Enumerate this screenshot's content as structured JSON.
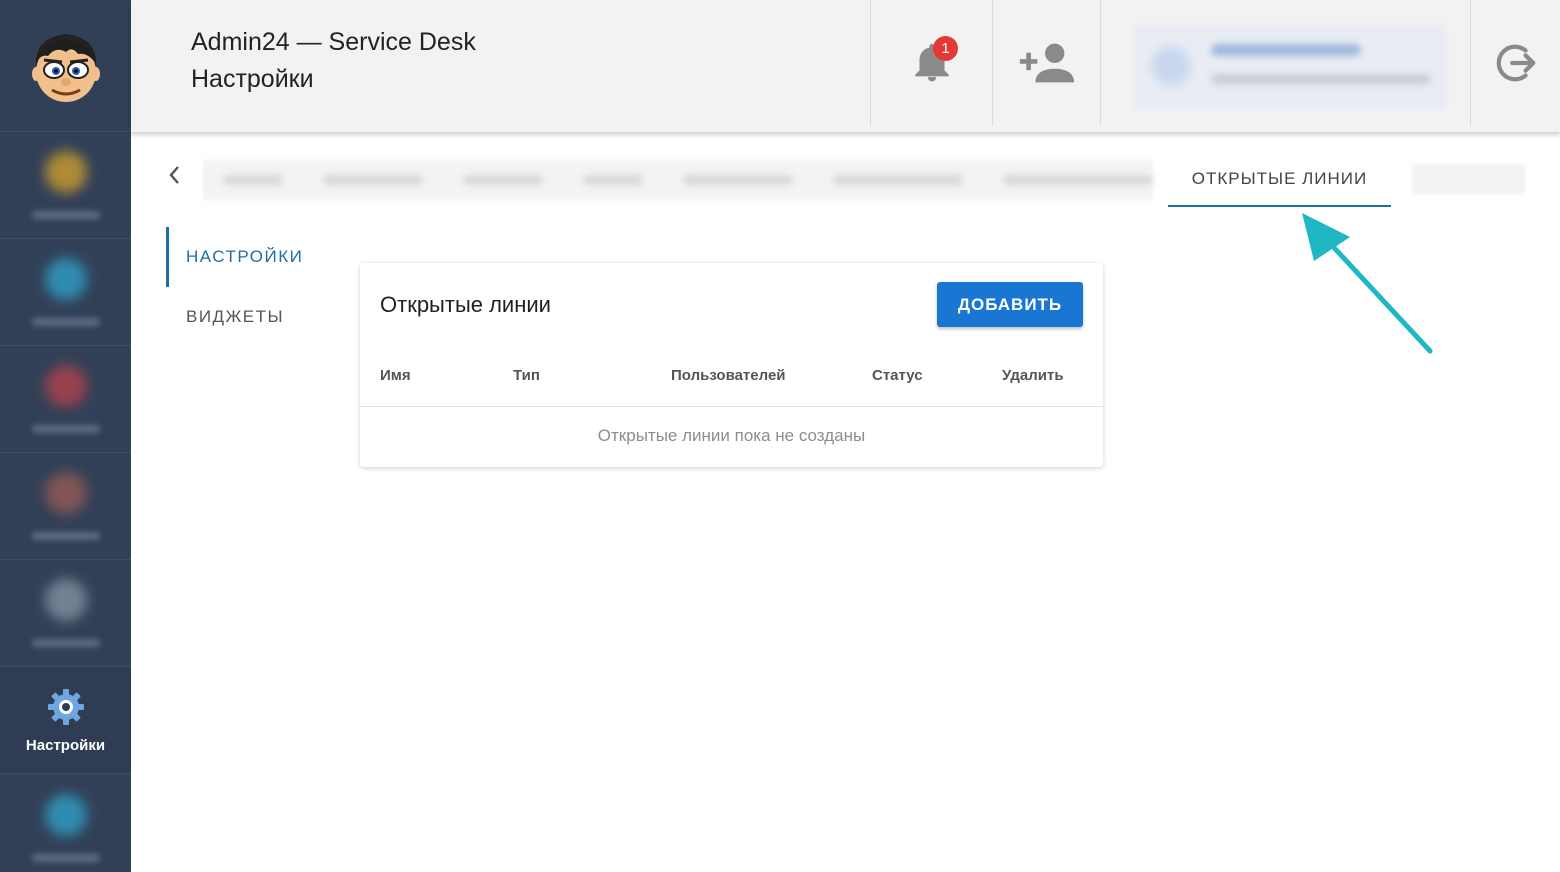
{
  "header": {
    "app_title": "Admin24 — Service Desk",
    "page_subtitle": "Настройки",
    "notifications_count": "1"
  },
  "sidebar": {
    "active_item_label": "Настройки"
  },
  "tabs": {
    "active_label": "ОТКРЫТЫЕ ЛИНИИ"
  },
  "settings_menu": {
    "items": [
      {
        "label": "НАСТРОЙКИ",
        "active": true
      },
      {
        "label": "ВИДЖЕТЫ",
        "active": false
      }
    ]
  },
  "card": {
    "title": "Открытые линии",
    "add_button": "ДОБАВИТЬ",
    "columns": [
      "Имя",
      "Тип",
      "Пользователей",
      "Статус",
      "Удалить"
    ],
    "empty_message": "Открытые линии пока не созданы"
  },
  "colors": {
    "sidebar_bg": "#324057",
    "header_bg": "#f2f2f2",
    "accent": "#1976d2",
    "tab_underline": "#1d6ea8",
    "badge": "#e53935",
    "annotation_arrow": "#1fb7c4"
  },
  "icons": [
    "avatar-cartoon",
    "bell-icon",
    "add-user-icon",
    "logout-icon",
    "gear-icon",
    "chevron-left-icon"
  ]
}
